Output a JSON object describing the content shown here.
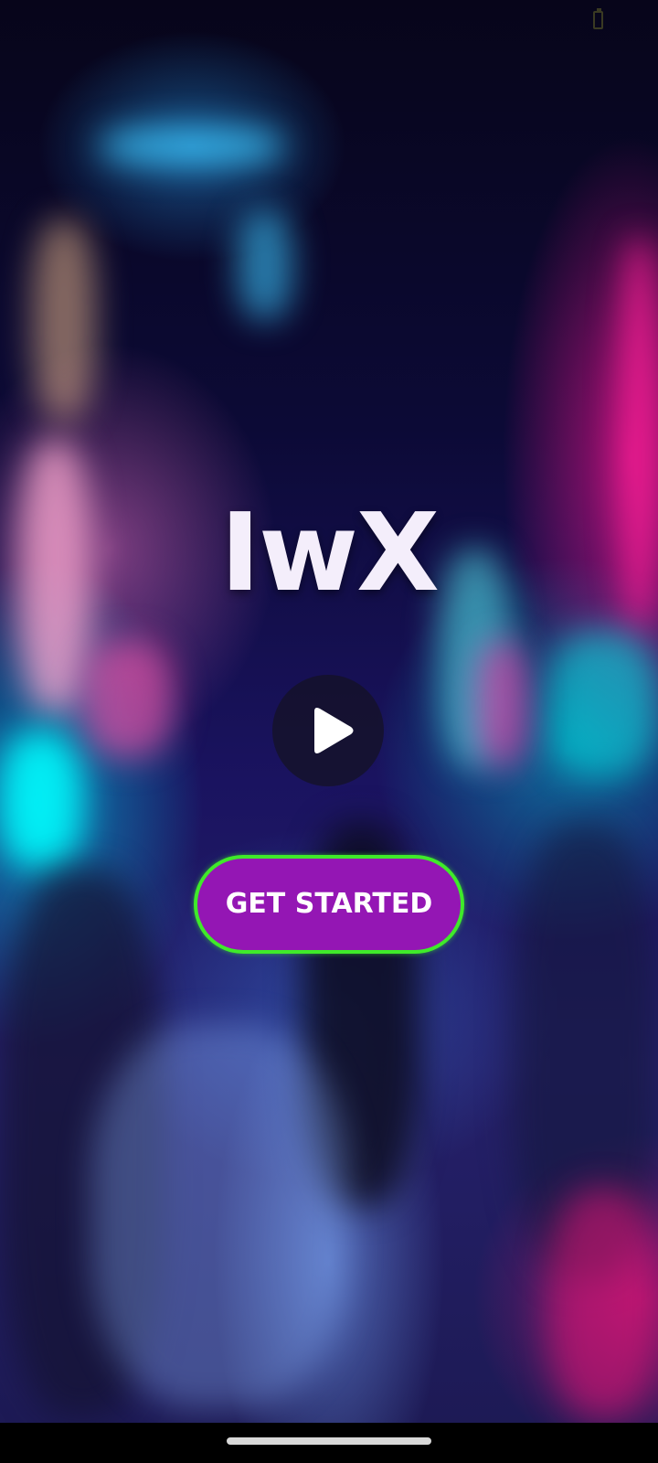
{
  "app": {
    "logo_text": "IwX"
  },
  "hero": {
    "play_icon": "play-icon",
    "cta_label": "GET STARTED"
  },
  "colors": {
    "cta_background": "#9416b4",
    "cta_border": "#3fea2a",
    "logo_text": "#f4eefb"
  }
}
